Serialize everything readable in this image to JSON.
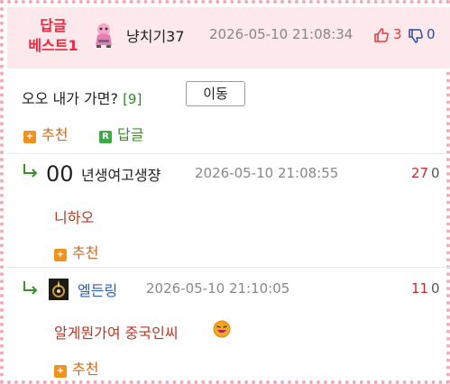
{
  "best": {
    "badge_line1": "답글",
    "badge_line2": "베스트1",
    "nickname": "냥치기37",
    "date": "2026-05-10 21:08:34",
    "upvotes": "3",
    "downvotes": "0"
  },
  "post": {
    "title": "오오 내가 가면?",
    "count": "[9]",
    "move_label": "이동"
  },
  "actions": {
    "recommend_label": "추천",
    "recommend_icon": "+",
    "reply_label": "답글",
    "reply_icon": "R"
  },
  "comments": [
    {
      "prefix": "00",
      "nickname": "년생여고생쟝",
      "date": "2026-05-10 21:08:55",
      "up": "27",
      "down": "0",
      "text": "니하오",
      "recommend_label": "추천"
    },
    {
      "nickname": "엘든링",
      "date": "2026-05-10 21:10:05",
      "up": "11",
      "down": "0",
      "text": "알게뭔가여 중국인씨",
      "recommend_label": "추천"
    }
  ],
  "colors": {
    "accent_pink": "#e8283f",
    "header_bg": "#fde8ec",
    "border": "#f3a9b6",
    "comment_text": "#b53a26",
    "recommend_orange": "#f0921e",
    "reply_green": "#3eab47"
  }
}
